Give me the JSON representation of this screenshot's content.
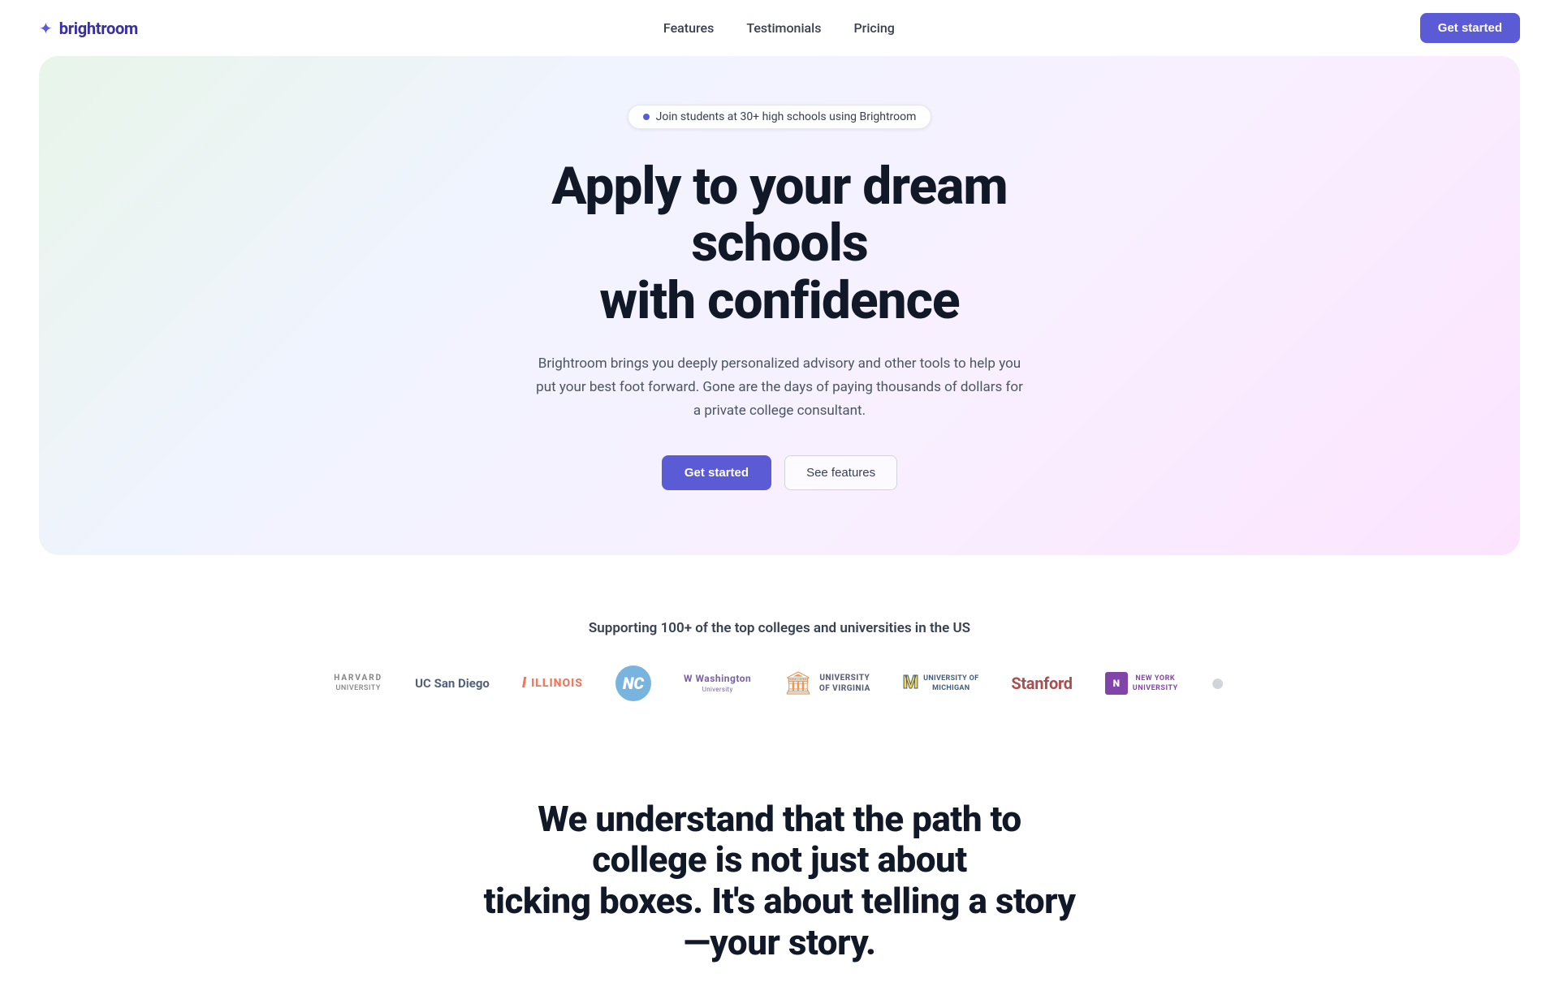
{
  "navbar": {
    "logo_icon": "✦",
    "logo_text": "brightroom",
    "links": [
      {
        "label": "Features",
        "href": "#features"
      },
      {
        "label": "Testimonials",
        "href": "#testimonials"
      },
      {
        "label": "Pricing",
        "href": "#pricing"
      }
    ],
    "cta_label": "Get started"
  },
  "hero": {
    "badge_text": "Join students at 30+ high schools using Brightroom",
    "title_line1": "Apply to your dream schools",
    "title_line2": "with confidence",
    "subtitle": "Brightroom brings you deeply personalized advisory and other tools to help you put your best foot forward. Gone are the days of paying thousands of dollars for a private college consultant.",
    "btn_primary": "Get started",
    "btn_secondary": "See features"
  },
  "universities": {
    "section_title": "Supporting 100+ of the top colleges and universities in the US",
    "logos": [
      {
        "name": "Harvard University",
        "display": "HARVARD\nUNIVERSITY",
        "style": "harvard"
      },
      {
        "name": "UC San Diego",
        "display": "UC San Diego",
        "style": "ucsd"
      },
      {
        "name": "University of Illinois",
        "display": "I ILLINOIS",
        "style": "illinois"
      },
      {
        "name": "University of North Carolina",
        "display": "NC",
        "style": "unc"
      },
      {
        "name": "University of Washington",
        "display": "Washington",
        "style": "washington"
      },
      {
        "name": "University of Virginia",
        "display": "UNIVERSITY\nOF VIRGINIA",
        "style": "uva"
      },
      {
        "name": "University of Michigan",
        "display": "M UNIVERSITY OF\nMICHIGAN",
        "style": "michigan"
      },
      {
        "name": "Stanford University",
        "display": "Stanford",
        "style": "stanford"
      },
      {
        "name": "New York University",
        "display": "NEW YORK\nUNIVERSITY",
        "style": "nyu"
      }
    ]
  },
  "bottom_section": {
    "title_line1": "We understand that the path to college is not just about",
    "title_line2": "ticking boxes. It's about telling a story—your story."
  }
}
